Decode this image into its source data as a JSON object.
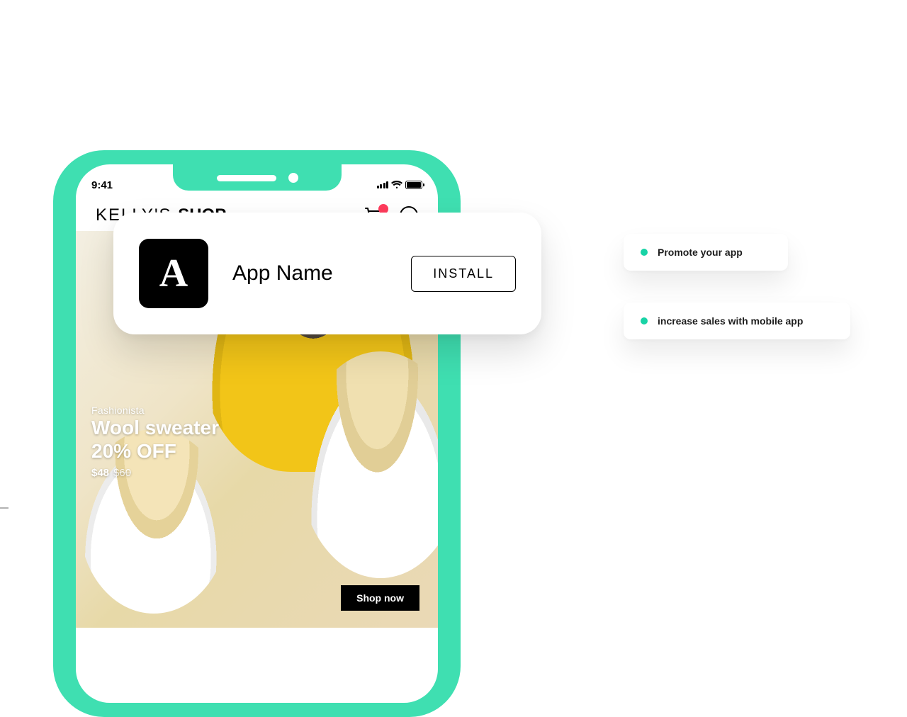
{
  "colors": {
    "accent": "#3fdfb1",
    "badge": "#ff3b5c"
  },
  "phone": {
    "time": "9:41",
    "shop_title_thin": "KELLY'S ",
    "shop_title_bold": "SHOP",
    "cart_count": "",
    "hero": {
      "category": "Fashionista",
      "line1": "Wool sweater",
      "line2": "20% OFF",
      "price": "$48",
      "price_old": "$60",
      "cta": "Shop now"
    }
  },
  "overlay": {
    "app_letter": "A",
    "app_name": "App Name",
    "install_label": "INSTALL"
  },
  "tags": {
    "t1": "Promote your app",
    "t2": "increase sales with mobile app"
  }
}
